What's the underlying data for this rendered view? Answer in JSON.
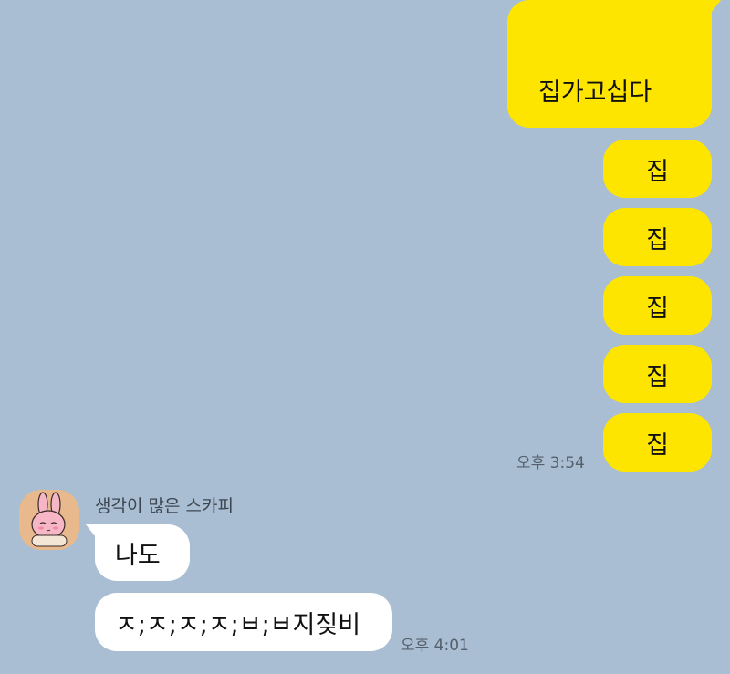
{
  "outgoing": {
    "first_message": "집가고십다",
    "messages": [
      "집",
      "집",
      "집",
      "집",
      "집"
    ],
    "time": "오후 3:54"
  },
  "incoming": {
    "sender_name": "생각이 많은 스카피",
    "messages": [
      "나도",
      "ㅈ;ㅈ;ㅈ;ㅈ;ㅂ;ㅂ지짖비"
    ],
    "time": "오후 4:01"
  },
  "colors": {
    "background": "#a9bed3",
    "outgoing_bubble": "#fee500",
    "incoming_bubble": "#ffffff"
  },
  "icons": {
    "avatar": "pink-rabbit-character-avatar"
  }
}
